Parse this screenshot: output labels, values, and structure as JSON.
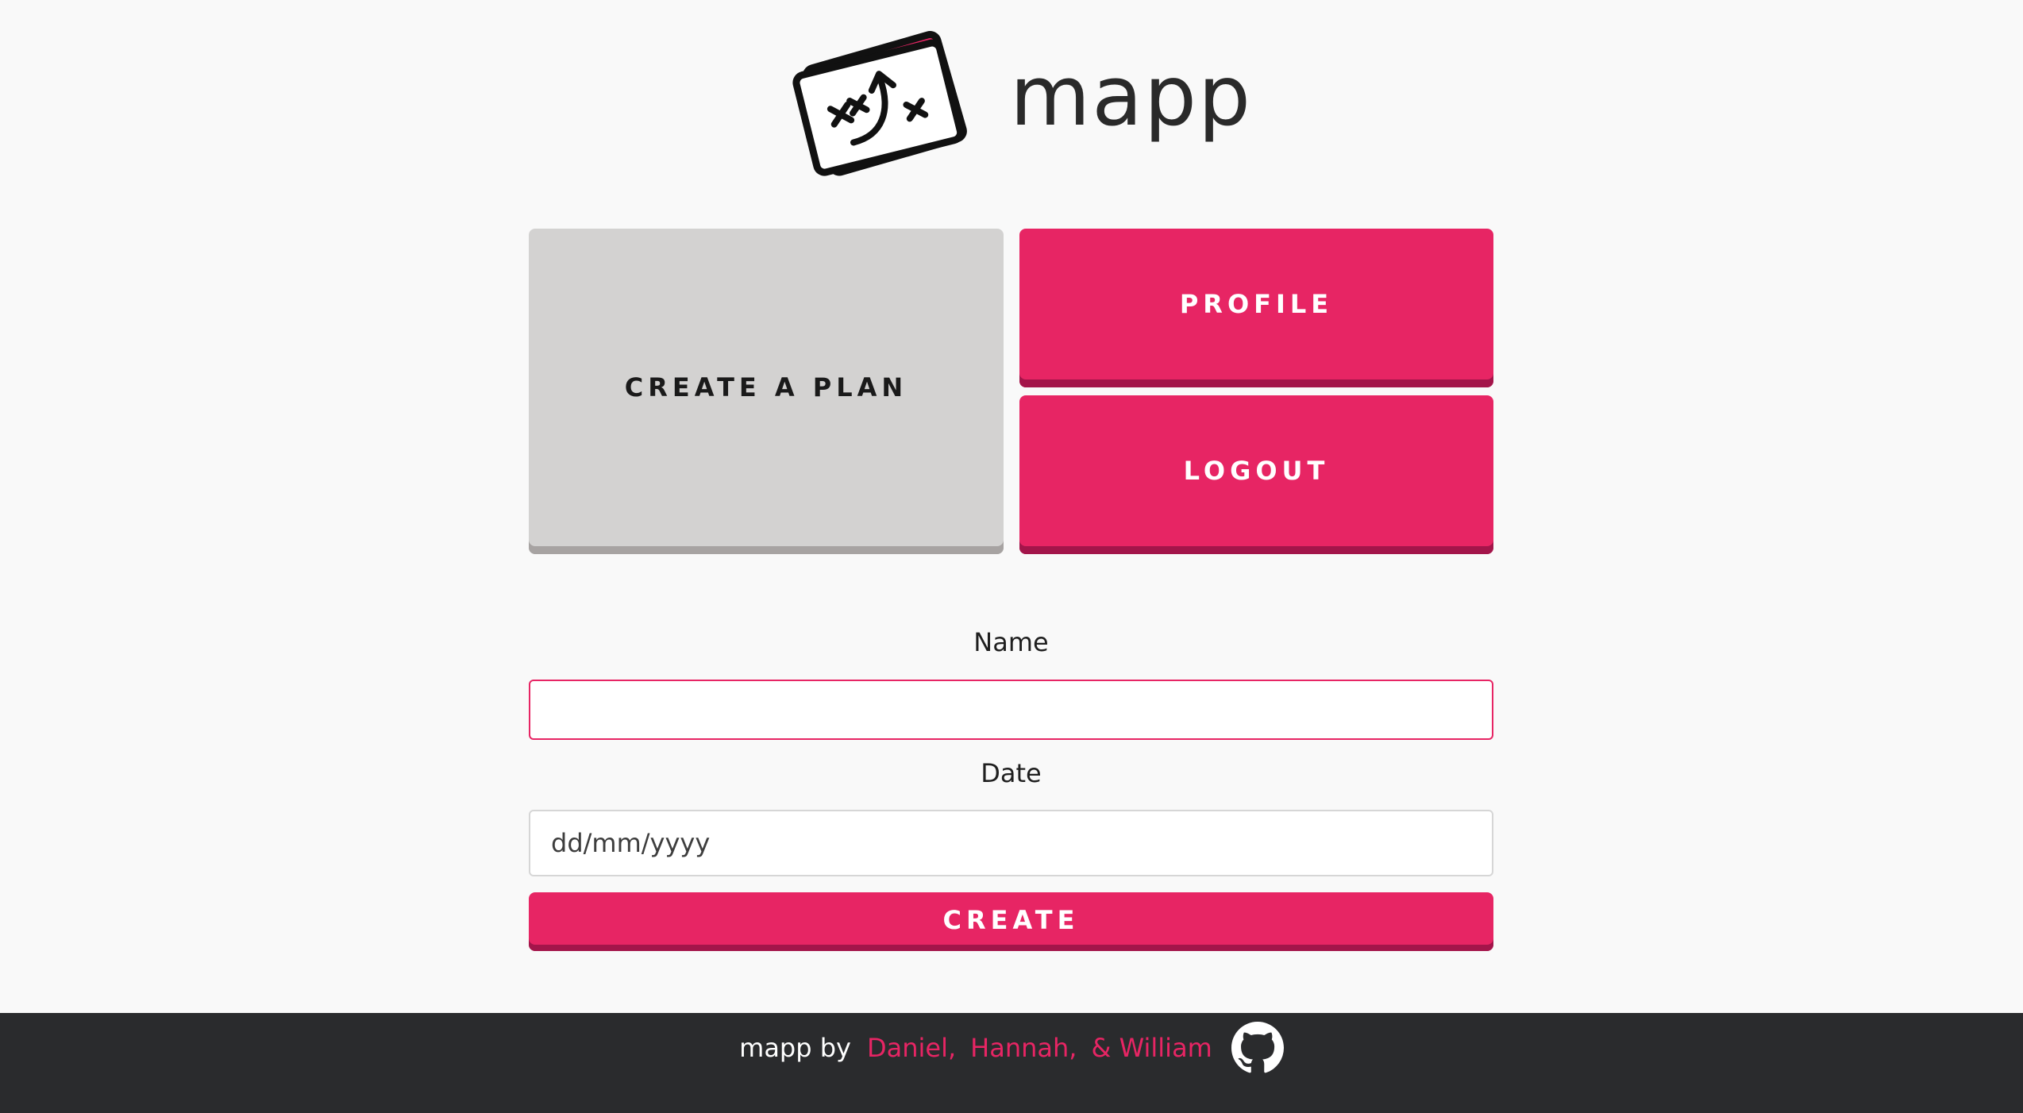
{
  "brand": {
    "name": "mapp",
    "logo_icon": "map-plan-icon",
    "accent_color": "#e72564",
    "accent_dark_color": "#a3154a",
    "tile_grey_color": "#d3d2d1"
  },
  "actions": {
    "create_plan_label": "CREATE A PLAN",
    "profile_label": "PROFILE",
    "logout_label": "LOGOUT"
  },
  "form": {
    "name_label": "Name",
    "name_value": "",
    "date_label": "Date",
    "date_placeholder": "dd/mm/yyyy",
    "submit_label": "CREATE"
  },
  "footer": {
    "prefix": "mapp by",
    "authors": [
      "Daniel,",
      "Hannah,",
      "& William"
    ],
    "repo_icon": "github-icon",
    "background_color": "#2a2b2d"
  }
}
